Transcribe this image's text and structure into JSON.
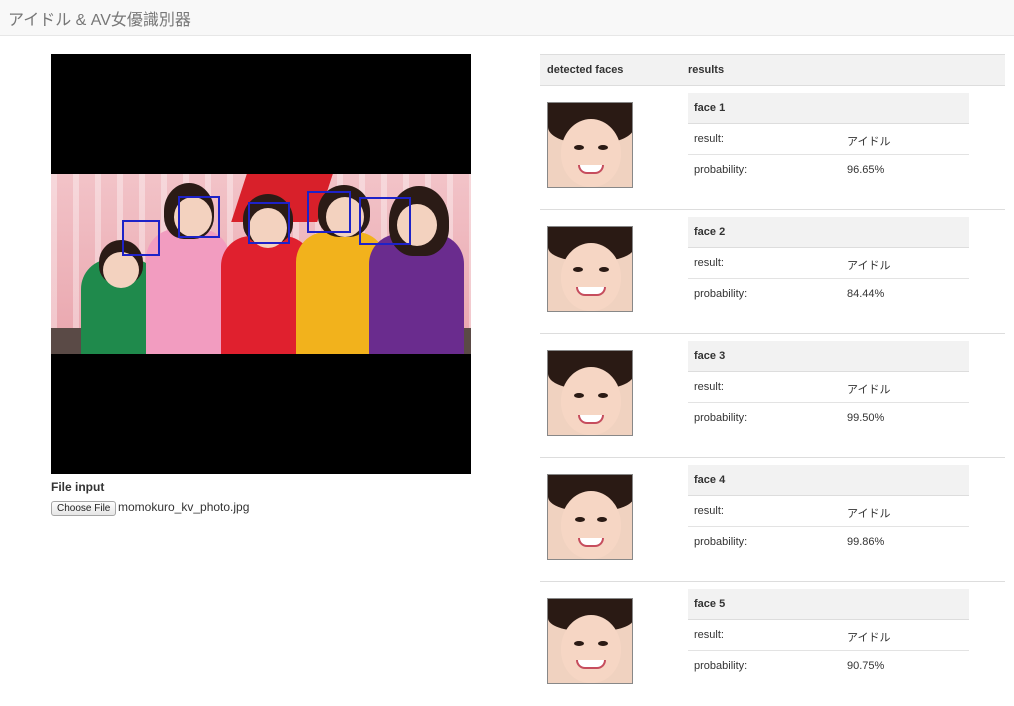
{
  "navbar": {
    "brand": "アイドル & AV女優識別器"
  },
  "upload": {
    "label": "File input",
    "button_label": "Choose File",
    "file_name": "momokuro_kv_photo.jpg"
  },
  "results_table": {
    "col_detected": "detected faces",
    "col_results": "results",
    "result_key": "result:",
    "probability_key": "probability:",
    "faces": [
      {
        "title": "face 1",
        "result": "アイドル",
        "probability": "96.65%"
      },
      {
        "title": "face 2",
        "result": "アイドル",
        "probability": "84.44%"
      },
      {
        "title": "face 3",
        "result": "アイドル",
        "probability": "99.50%"
      },
      {
        "title": "face 4",
        "result": "アイドル",
        "probability": "99.86%"
      },
      {
        "title": "face 5",
        "result": "アイドル",
        "probability": "90.75%"
      }
    ]
  },
  "colors": {
    "face_box": "#1e22c8",
    "outfits": [
      "#1f8a4c",
      "#f29cc0",
      "#e0202e",
      "#f2b21c",
      "#6a2c8e"
    ]
  }
}
